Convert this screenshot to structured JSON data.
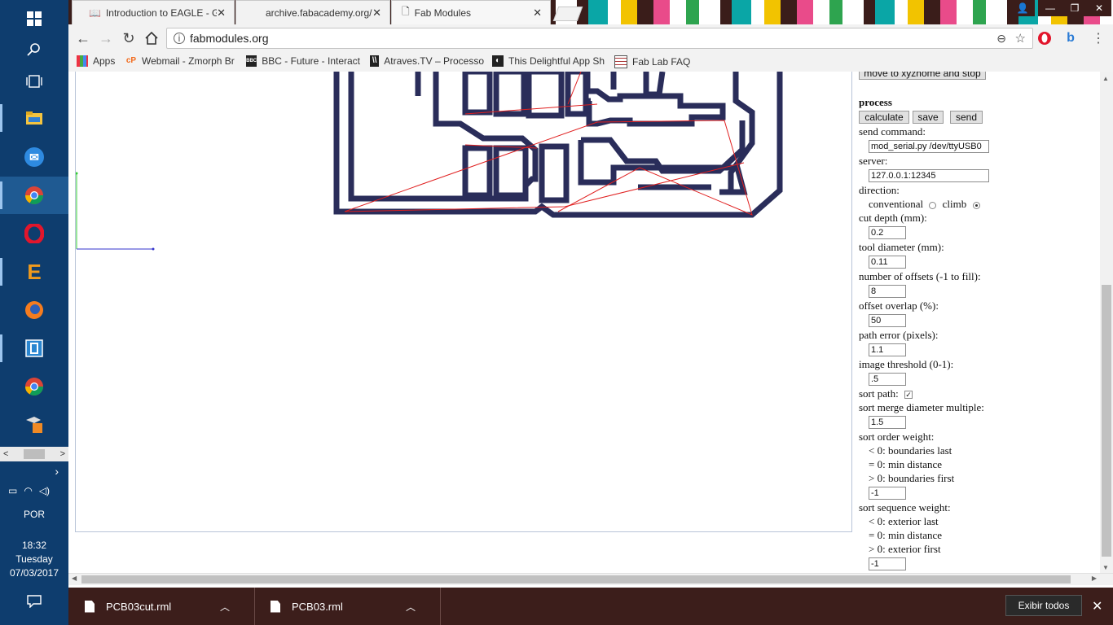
{
  "taskbar": {
    "language": "POR",
    "time": "18:32",
    "day": "Tuesday",
    "date": "07/03/2017"
  },
  "tabs": [
    {
      "label": "Introduction to EAGLE - G",
      "icon": "book-icon"
    },
    {
      "label": "archive.fabacademy.org/",
      "icon": "loading-icon"
    },
    {
      "label": "Fab Modules",
      "icon": "page-icon"
    }
  ],
  "address": {
    "url": "fabmodules.org"
  },
  "bookmarks": [
    {
      "label": "Apps"
    },
    {
      "label": "Webmail - Zmorph Br"
    },
    {
      "label": "BBC - Future - Interact"
    },
    {
      "label": "Atraves.TV – Processo"
    },
    {
      "label": "This Delightful App Sh"
    },
    {
      "label": "Fab Lab FAQ"
    }
  ],
  "panel": {
    "top_button": "move to xyzhome and stop",
    "process_heading": "process",
    "buttons": {
      "calculate": "calculate",
      "save": "save",
      "send": "send"
    },
    "send_command_label": "send command:",
    "send_command_value": "mod_serial.py /dev/ttyUSB0",
    "server_label": "server:",
    "server_value": "127.0.0.1:12345",
    "direction_label": "direction:",
    "conventional_label": "conventional",
    "climb_label": "climb",
    "cut_depth_label": "cut depth (mm):",
    "cut_depth_value": "0.2",
    "tool_diameter_label": "tool diameter (mm):",
    "tool_diameter_value": "0.11",
    "offsets_label": "number of offsets (-1 to fill):",
    "offsets_value": "8",
    "overlap_label": "offset overlap (%):",
    "overlap_value": "50",
    "path_error_label": "path error (pixels):",
    "path_error_value": "1.1",
    "threshold_label": "image threshold (0-1):",
    "threshold_value": ".5",
    "sort_path_label": "sort path:",
    "merge_label": "sort merge diameter multiple:",
    "merge_value": "1.5",
    "order_label": "sort order weight:",
    "order_opts": [
      "< 0: boundaries last",
      "= 0: min distance",
      "> 0: boundaries first"
    ],
    "order_value": "-1",
    "sequence_label": "sort sequence weight:",
    "sequence_opts": [
      "< 0: exterior last",
      "= 0: min distance",
      "> 0: exterior first"
    ],
    "sequence_value": "-1"
  },
  "downloads": [
    {
      "name": "PCB03cut.rml"
    },
    {
      "name": "PCB03.rml"
    }
  ],
  "show_all": "Exibir todos"
}
